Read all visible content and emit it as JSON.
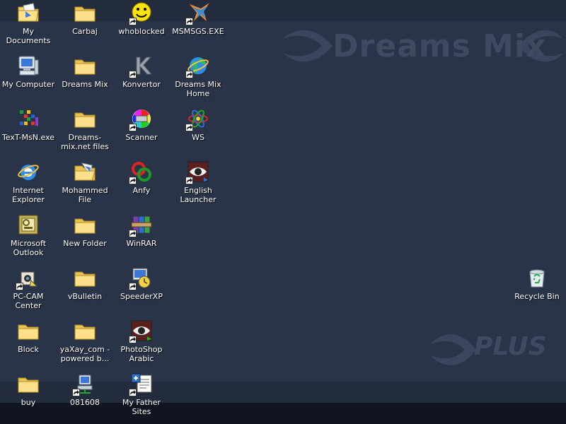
{
  "wallpaper": {
    "brand": "Dreams Mix",
    "sub": "PLUS"
  },
  "icons": [
    {
      "id": "my-documents",
      "label": "My Documents",
      "glyph": "documents-folder-icon"
    },
    {
      "id": "carbaj",
      "label": "Carbaj",
      "glyph": "folder-icon"
    },
    {
      "id": "whoblocked",
      "label": "whoblocked",
      "glyph": "smiley-icon",
      "shortcut": true
    },
    {
      "id": "msmsgs",
      "label": "MSMSGS.EXE",
      "glyph": "messenger-icon",
      "shortcut": true
    },
    {
      "id": "my-computer",
      "label": "My Computer",
      "glyph": "computer-icon"
    },
    {
      "id": "dreams-mix",
      "label": "Dreams Mix",
      "glyph": "folder-icon"
    },
    {
      "id": "konvertor",
      "label": "Konvertor",
      "glyph": "k-logo-icon",
      "shortcut": true
    },
    {
      "id": "dreams-mix-home",
      "label": "Dreams Mix Home",
      "glyph": "internet-globe-icon",
      "shortcut": true
    },
    {
      "id": "text-msn",
      "label": "TexT-MsN.exe",
      "glyph": "grid-app-icon"
    },
    {
      "id": "dreams-mix-net-files",
      "label": "Dreams-mix.net files",
      "glyph": "folder-icon"
    },
    {
      "id": "scanner",
      "label": "Scanner",
      "glyph": "color-wheel-icon",
      "shortcut": true
    },
    {
      "id": "ws",
      "label": "WS",
      "glyph": "atom-icon",
      "shortcut": true
    },
    {
      "id": "internet-explorer",
      "label": "Internet Explorer",
      "glyph": "ie-icon"
    },
    {
      "id": "mohammed-file",
      "label": "Mohammed File",
      "glyph": "open-folder-icon"
    },
    {
      "id": "anfy",
      "label": "Anfy",
      "glyph": "anfy-icon",
      "shortcut": true
    },
    {
      "id": "english-launcher",
      "label": "English Launcher",
      "glyph": "eye-icon",
      "shortcut": true
    },
    {
      "id": "microsoft-outlook",
      "label": "Microsoft Outlook",
      "glyph": "outlook-icon"
    },
    {
      "id": "new-folder",
      "label": "New Folder",
      "glyph": "folder-icon"
    },
    {
      "id": "winrar",
      "label": "WinRAR",
      "glyph": "winrar-icon",
      "shortcut": true
    },
    {
      "id": "pc-cam-center",
      "label": "PC-CAM Center",
      "glyph": "camera-icon",
      "shortcut": true
    },
    {
      "id": "vbulletin",
      "label": "vBulletin",
      "glyph": "folder-icon"
    },
    {
      "id": "speederxp",
      "label": "SpeederXP",
      "glyph": "stopwatch-icon",
      "shortcut": true
    },
    {
      "id": "recycle-bin",
      "label": "Recycle Bin",
      "glyph": "recycle-bin-icon"
    },
    {
      "id": "block",
      "label": "Block",
      "glyph": "folder-icon"
    },
    {
      "id": "yaxay",
      "label": "yaXay_com - powered b...",
      "glyph": "folder-icon"
    },
    {
      "id": "photoshop-arabic",
      "label": "PhotoShop Arabic",
      "glyph": "eye-icon",
      "shortcut": true
    },
    {
      "id": "buy",
      "label": "buy",
      "glyph": "folder-icon"
    },
    {
      "id": "081608",
      "label": "081608",
      "glyph": "network-computer-icon",
      "shortcut": true
    },
    {
      "id": "my-father-sites",
      "label": "My Father Sites",
      "glyph": "sitemap-icon",
      "shortcut": true
    }
  ]
}
